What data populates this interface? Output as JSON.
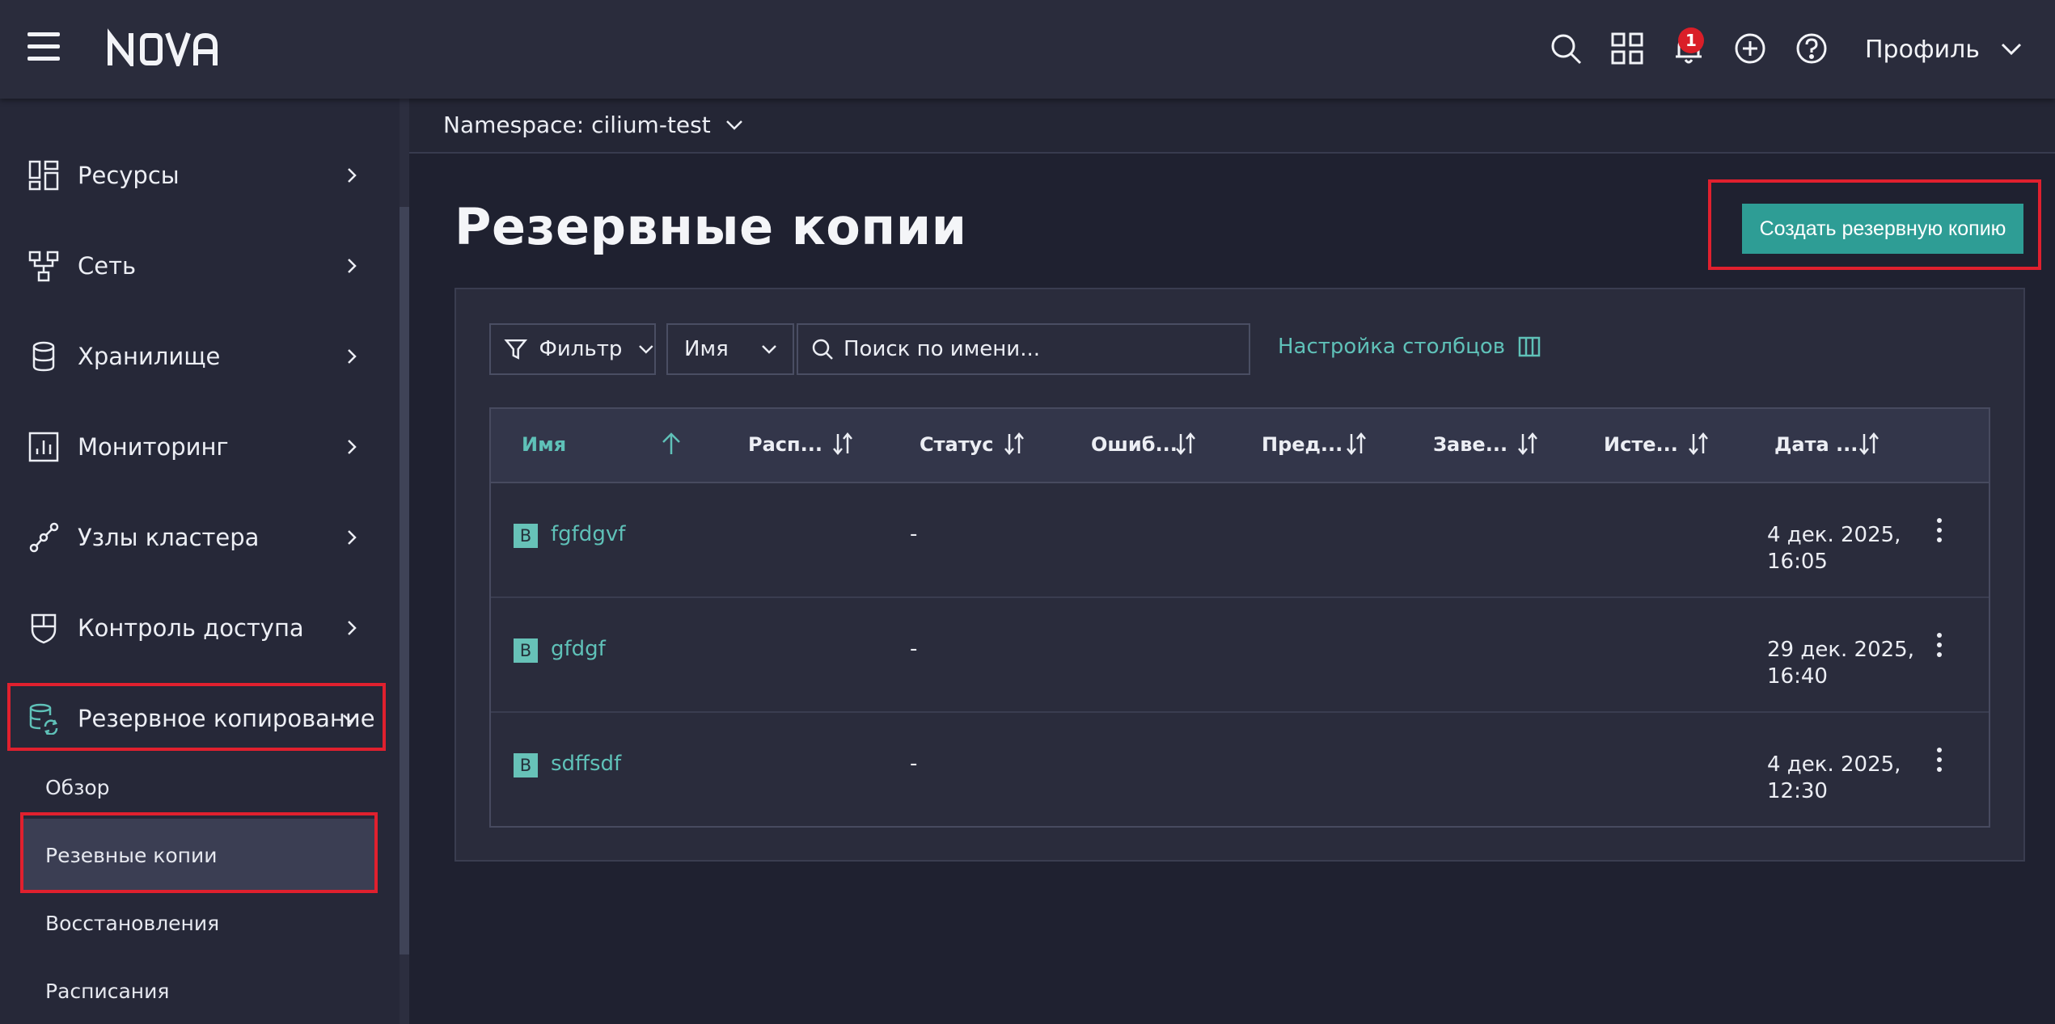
{
  "header": {
    "logo_text": "NOVA",
    "notification_count": "1",
    "profile_label": "Профиль"
  },
  "sidebar": {
    "items": [
      {
        "label": "Ресурсы",
        "icon": "resources-icon"
      },
      {
        "label": "Сеть",
        "icon": "network-icon"
      },
      {
        "label": "Хранилище",
        "icon": "storage-icon"
      },
      {
        "label": "Мониторинг",
        "icon": "monitoring-icon"
      },
      {
        "label": "Узлы кластера",
        "icon": "cluster-nodes-icon"
      },
      {
        "label": "Контроль доступа",
        "icon": "access-control-icon"
      },
      {
        "label": "Резервное копирование",
        "icon": "backup-icon"
      }
    ],
    "subitems": [
      {
        "label": "Обзор"
      },
      {
        "label": "Резевные копии"
      },
      {
        "label": "Восстановления"
      },
      {
        "label": "Расписания"
      }
    ]
  },
  "namespace": {
    "label": "Namespace: cilium-test"
  },
  "main": {
    "title": "Резервные копии",
    "create_button": "Создать резервную копию",
    "toolbar": {
      "filter_label": "Фильтр",
      "field_select": "Имя",
      "search_placeholder": "Поиск по имени...",
      "column_settings": "Настройка столбцов"
    },
    "table": {
      "columns": [
        {
          "label": "Имя"
        },
        {
          "label": "Расп..."
        },
        {
          "label": "Статус"
        },
        {
          "label": "Ошиб..."
        },
        {
          "label": "Пред..."
        },
        {
          "label": "Заве..."
        },
        {
          "label": "Исте..."
        },
        {
          "label": "Дата ..."
        }
      ],
      "rows": [
        {
          "badge": "B",
          "name": "fgfdgvf",
          "status": "-",
          "date": "4 дек. 2025, 16:05"
        },
        {
          "badge": "B",
          "name": "gfdgf",
          "status": "-",
          "date": "29 дек. 2025, 16:40"
        },
        {
          "badge": "B",
          "name": "sdffsdf",
          "status": "-",
          "date": "4 дек. 2025, 12:30"
        }
      ]
    }
  },
  "colors": {
    "accent": "#5fc1b8",
    "button": "#2e9d95",
    "highlight": "#e0202e",
    "badge": "#da1e28"
  }
}
